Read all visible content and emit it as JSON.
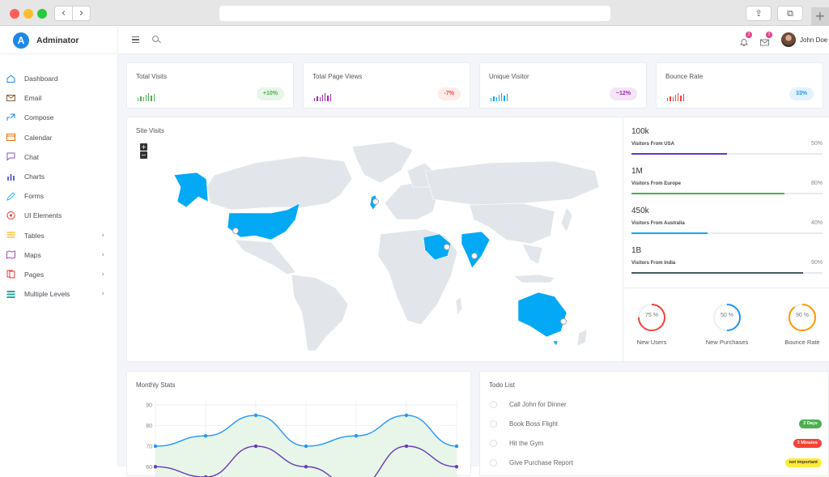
{
  "app": {
    "name": "Adminator",
    "logo_letter": "A"
  },
  "sidebar": {
    "items": [
      {
        "label": "Dashboard",
        "icon": "home-icon",
        "color": "#1e88e5",
        "submenu": false
      },
      {
        "label": "Email",
        "icon": "mail-icon",
        "color": "#8e5b3c",
        "submenu": false
      },
      {
        "label": "Compose",
        "icon": "share-icon",
        "color": "#1e88e5",
        "submenu": false
      },
      {
        "label": "Calendar",
        "icon": "calendar-icon",
        "color": "#ef6c00",
        "submenu": false
      },
      {
        "label": "Chat",
        "icon": "chat-icon",
        "color": "#7e57c2",
        "submenu": false
      },
      {
        "label": "Charts",
        "icon": "bar-chart-icon",
        "color": "#5c6bc0",
        "submenu": false
      },
      {
        "label": "Forms",
        "icon": "pencil-icon",
        "color": "#29b6f6",
        "submenu": false
      },
      {
        "label": "UI Elements",
        "icon": "palette-icon",
        "color": "#e53935",
        "submenu": false
      },
      {
        "label": "Tables",
        "icon": "list-icon",
        "color": "#fbc02d",
        "submenu": true
      },
      {
        "label": "Maps",
        "icon": "map-icon",
        "color": "#ab47bc",
        "submenu": true
      },
      {
        "label": "Pages",
        "icon": "files-icon",
        "color": "#e53935",
        "submenu": true
      },
      {
        "label": "Multiple Levels",
        "icon": "layers-icon",
        "color": "#26a69a",
        "submenu": true
      }
    ]
  },
  "header": {
    "user_name": "John Doe",
    "notifications_count": "3",
    "messages_count": "3"
  },
  "kpis": [
    {
      "title": "Total Visits",
      "change": "+10%",
      "color": "#4caf50",
      "pill_bg": "#e8f5e9"
    },
    {
      "title": "Total Page Views",
      "change": "-7%",
      "color": "#9c27b0",
      "pill_bg": "#fdecea",
      "pill_color": "#f44336"
    },
    {
      "title": "Unique Visitor",
      "change": "~12%",
      "color": "#03a9f4",
      "pill_bg": "#f3e5f5",
      "pill_color": "#9c27b0"
    },
    {
      "title": "Bounce Rate",
      "change": "33%",
      "color": "#f44336",
      "pill_bg": "#e3f2fd",
      "pill_color": "#2196f3"
    }
  ],
  "site_visits": {
    "title": "Site Visits",
    "zoom_in": "+",
    "zoom_out": "−",
    "highlight_color": "#03a9f4",
    "land_color": "#e2e6ea",
    "stats": [
      {
        "value": "100k",
        "label": "Visitors From USA",
        "percent": "50%",
        "fraction": 0.5,
        "color": "#673ab7"
      },
      {
        "value": "1M",
        "label": "Visitors From Europe",
        "percent": "80%",
        "fraction": 0.8,
        "color": "#4caf50"
      },
      {
        "value": "450k",
        "label": "Visitors From Australia",
        "percent": "40%",
        "fraction": 0.4,
        "color": "#03a9f4"
      },
      {
        "value": "1B",
        "label": "Visitors From India",
        "percent": "90%",
        "fraction": 0.9,
        "color": "#455a64"
      }
    ],
    "donuts": [
      {
        "label": "New Users",
        "value_text": "75 %",
        "fraction": 0.75,
        "color": "#f44336"
      },
      {
        "label": "New Purchases",
        "value_text": "50 %",
        "fraction": 0.5,
        "color": "#2196f3"
      },
      {
        "label": "Bounce Rate",
        "value_text": "90 %",
        "fraction": 0.9,
        "color": "#ff9800"
      }
    ]
  },
  "monthly_stats": {
    "title": "Monthly Stats",
    "chart_data": {
      "type": "line",
      "x": [
        0,
        1,
        2,
        3,
        4,
        5,
        6
      ],
      "yticks": [
        60,
        70,
        80,
        90
      ],
      "ylim": [
        55,
        92
      ],
      "series": [
        {
          "values": [
            70,
            75,
            85,
            70,
            75,
            85,
            70
          ],
          "color": "#2196f3",
          "fill": "#e8f5e9"
        },
        {
          "values": [
            60,
            55,
            70,
            60,
            50,
            70,
            60
          ],
          "color": "#673ab7"
        }
      ]
    }
  },
  "todo": {
    "title": "Todo List",
    "items": [
      {
        "text": "Call John for Dinner",
        "tag": "",
        "tag_bg": "",
        "tag_color": ""
      },
      {
        "text": "Book Boss Flight",
        "tag": "2 Days",
        "tag_bg": "#4caf50",
        "tag_color": "#ffffff"
      },
      {
        "text": "Hit the Gym",
        "tag": "3 Minutes",
        "tag_bg": "#f44336",
        "tag_color": "#ffffff"
      },
      {
        "text": "Give Purchase Report",
        "tag": "not important",
        "tag_bg": "#ffeb3b",
        "tag_color": "#333333"
      }
    ]
  }
}
